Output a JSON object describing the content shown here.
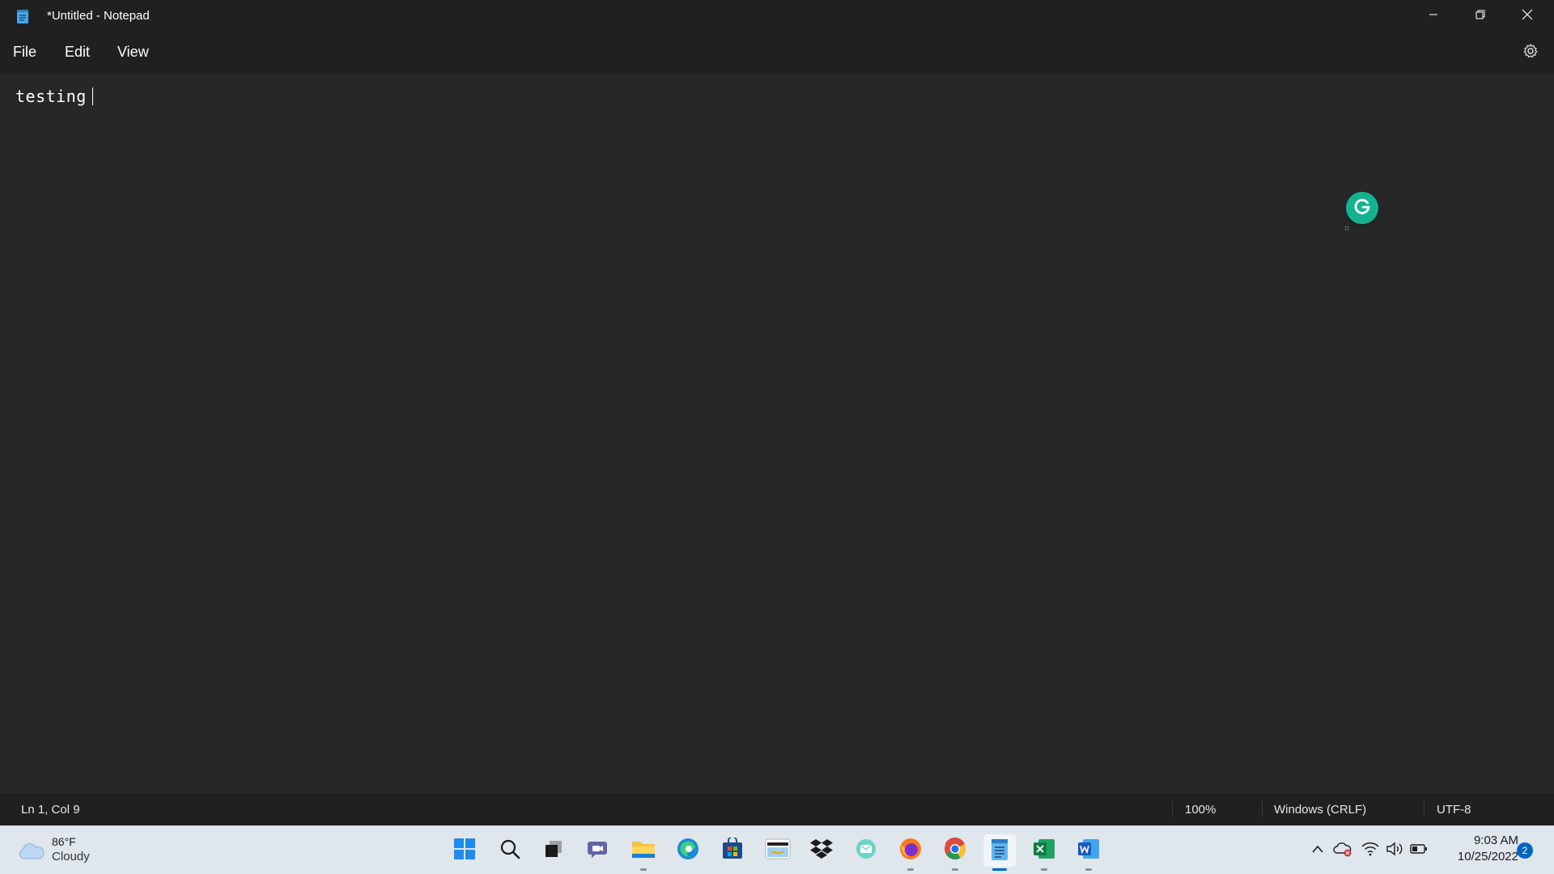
{
  "window": {
    "title": "*Untitled - Notepad",
    "minimize_icon": "minimize-icon",
    "maximize_icon": "restore-icon",
    "close_icon": "close-icon"
  },
  "menu": {
    "items": [
      {
        "label": "File"
      },
      {
        "label": "Edit"
      },
      {
        "label": "View"
      }
    ],
    "settings_icon": "gear-icon"
  },
  "editor": {
    "content": "testing ",
    "grammarly_icon": "grammarly-icon"
  },
  "status": {
    "position": "Ln 1, Col 9",
    "zoom": "100%",
    "line_endings": "Windows (CRLF)",
    "encoding": "UTF-8"
  },
  "taskbar": {
    "weather": {
      "temp": "86°F",
      "condition": "Cloudy",
      "icon": "cloud-icon"
    },
    "apps": [
      {
        "name": "start",
        "icon": "windows-start-icon",
        "running": false
      },
      {
        "name": "search",
        "icon": "search-icon",
        "running": false
      },
      {
        "name": "task-view",
        "icon": "task-view-icon",
        "running": false
      },
      {
        "name": "teams",
        "icon": "teams-chat-icon",
        "running": false
      },
      {
        "name": "file-explorer",
        "icon": "folder-icon",
        "running": true
      },
      {
        "name": "edge",
        "icon": "edge-icon",
        "running": false
      },
      {
        "name": "store",
        "icon": "store-icon",
        "running": false
      },
      {
        "name": "amazon",
        "icon": "amazon-icon",
        "running": false
      },
      {
        "name": "dropbox",
        "icon": "dropbox-icon",
        "running": false
      },
      {
        "name": "mail",
        "icon": "mail-icon",
        "running": false
      },
      {
        "name": "firefox",
        "icon": "firefox-icon",
        "running": true
      },
      {
        "name": "chrome",
        "icon": "chrome-icon",
        "running": true
      },
      {
        "name": "notepad",
        "icon": "notepad-icon",
        "running": true,
        "active": true
      },
      {
        "name": "excel",
        "icon": "excel-icon",
        "running": true
      },
      {
        "name": "word",
        "icon": "word-icon",
        "running": true
      }
    ],
    "tray": {
      "icons": [
        "chevron-up-icon",
        "onedrive-error-icon",
        "wifi-icon",
        "volume-icon",
        "battery-icon"
      ],
      "time": "9:03 AM",
      "date": "10/25/2022",
      "notifications": "2"
    }
  },
  "colors": {
    "editor_bg": "#272727",
    "chrome_bg": "#202020",
    "taskbar_bg": "#dfe6ec",
    "accent": "#0067c0",
    "grammarly": "#15b290"
  }
}
